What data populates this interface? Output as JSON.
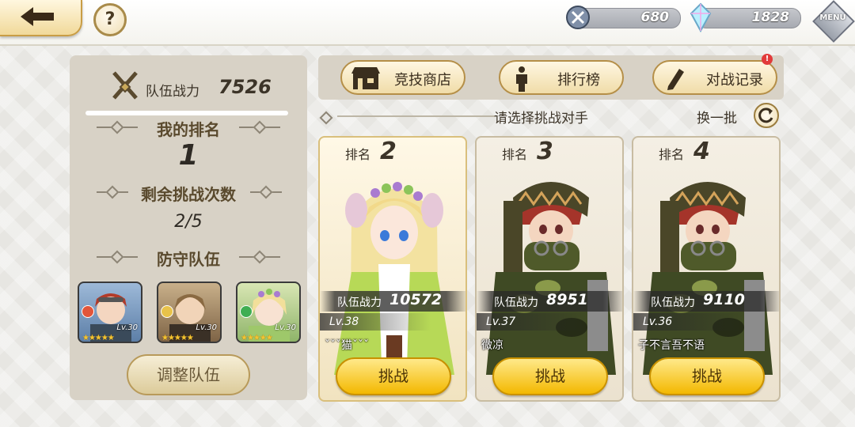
{
  "topbar": {
    "help_label": "?",
    "resources": [
      {
        "icon": "stamina-sword-icon",
        "value": "680"
      },
      {
        "icon": "crystal-icon",
        "value": "1828"
      }
    ],
    "menu_label": "MENU"
  },
  "left": {
    "power_label": "队伍战力",
    "power_value": "7526",
    "rank_title": "我的排名",
    "rank_value": "1",
    "remain_title": "剩余挑战次数",
    "remain_value": "2/5",
    "defense_title": "防守队伍",
    "team": [
      {
        "level": "Lv.30",
        "stars": "★★★★★",
        "element_color": "#e2553a"
      },
      {
        "level": "Lv.30",
        "stars": "★★★★★",
        "element_color": "#e8c24a"
      },
      {
        "level": "Lv.30",
        "stars": "★★★★★",
        "element_color": "#3fae52"
      }
    ],
    "adjust_label": "调整队伍"
  },
  "right": {
    "shop_label": "竞技商店",
    "ranking_label": "排行榜",
    "record_label": "对战记录",
    "record_badge": "!",
    "select_label": "请选择挑战对手",
    "refresh_label": "换一批"
  },
  "opponents": [
    {
      "rank_label": "排名",
      "rank": "2",
      "power_label": "队伍战力",
      "power": "10572",
      "level": "Lv.38",
      "name": "ˇˇˇ猫ˇˇˇ",
      "button": "挑战"
    },
    {
      "rank_label": "排名",
      "rank": "3",
      "power_label": "队伍战力",
      "power": "8951",
      "level": "Lv.37",
      "name": "微凉",
      "button": "挑战"
    },
    {
      "rank_label": "排名",
      "rank": "4",
      "power_label": "队伍战力",
      "power": "9110",
      "level": "Lv.36",
      "name": "子不言吾不语",
      "button": "挑战"
    }
  ],
  "colors": {
    "accent_gold": "#f3b800",
    "panel_bg": "#d8d2c6",
    "badge_red": "#e23b3b"
  }
}
